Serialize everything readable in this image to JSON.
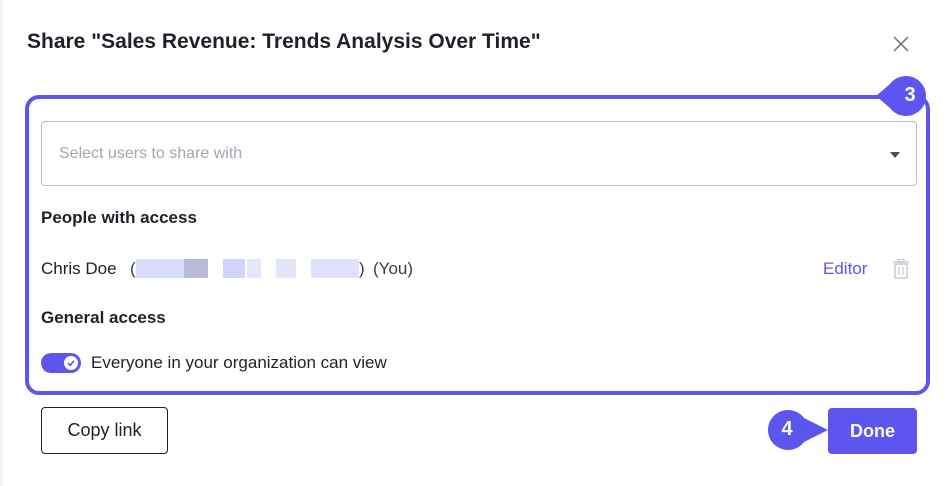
{
  "dialog": {
    "title": "Share \"Sales Revenue: Trends Analysis Over Time\"",
    "close_icon": "close-icon"
  },
  "share_select": {
    "placeholder": "Select users to share with",
    "icon": "chevron-down-icon"
  },
  "people_access": {
    "heading": "People with access",
    "people": [
      {
        "name": "Chris Doe",
        "paren_open": "(",
        "paren_close": ")",
        "suffix": "(You)",
        "role": "Editor",
        "delete_icon": "trash-icon"
      }
    ]
  },
  "general_access": {
    "heading": "General access",
    "toggle_on": true,
    "label": "Everyone in your organization can view"
  },
  "footer": {
    "copy_link_label": "Copy link",
    "done_label": "Done"
  },
  "step_badges": [
    {
      "number": "3"
    },
    {
      "number": "4"
    }
  ],
  "colors": {
    "accent": "#5c55ee",
    "text": "#1f2128",
    "placeholder": "#a2a6b0",
    "border": "#b9bcc4"
  }
}
